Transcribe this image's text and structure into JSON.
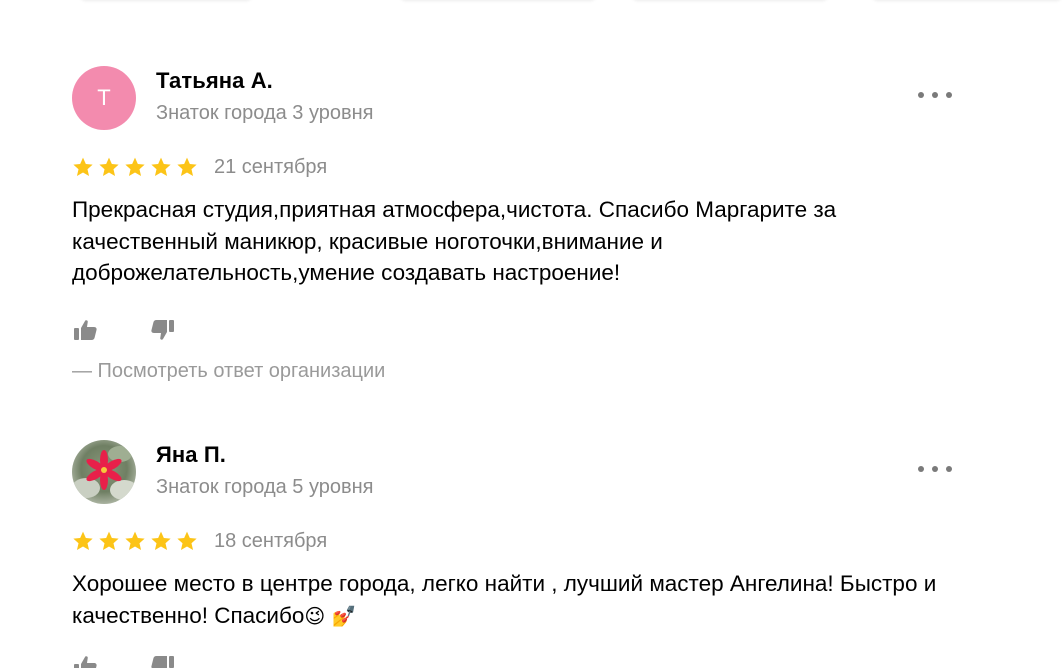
{
  "reviews": [
    {
      "author": {
        "name": "Татьяна А.",
        "level": "Знаток города 3 уровня",
        "avatar_letter": "Т",
        "avatar_color": "#f38bae"
      },
      "rating": 5,
      "date": "21 сентября",
      "text": "Прекрасная студия,приятная атмосфера,чистота. Спасибо Маргарите за качественный маникюр, красивые ноготочки,внимание и доброжелательность,умение создавать настроение!",
      "org_reply_link": "— Посмотреть ответ организации"
    },
    {
      "author": {
        "name": "Яна П.",
        "level": "Знаток города 5 уровня",
        "avatar_image": "red-flower-photo"
      },
      "rating": 5,
      "date": "18 сентября",
      "text_main": "Хорошее место в центре города, легко найти , лучший мастер Ангелина! Быстро и качественно! Спасибо",
      "text_emojis": "😉 💅"
    }
  ],
  "colors": {
    "star": "#fcc417",
    "secondary_text": "#8c8c8c",
    "icon": "#8a8a8a"
  }
}
